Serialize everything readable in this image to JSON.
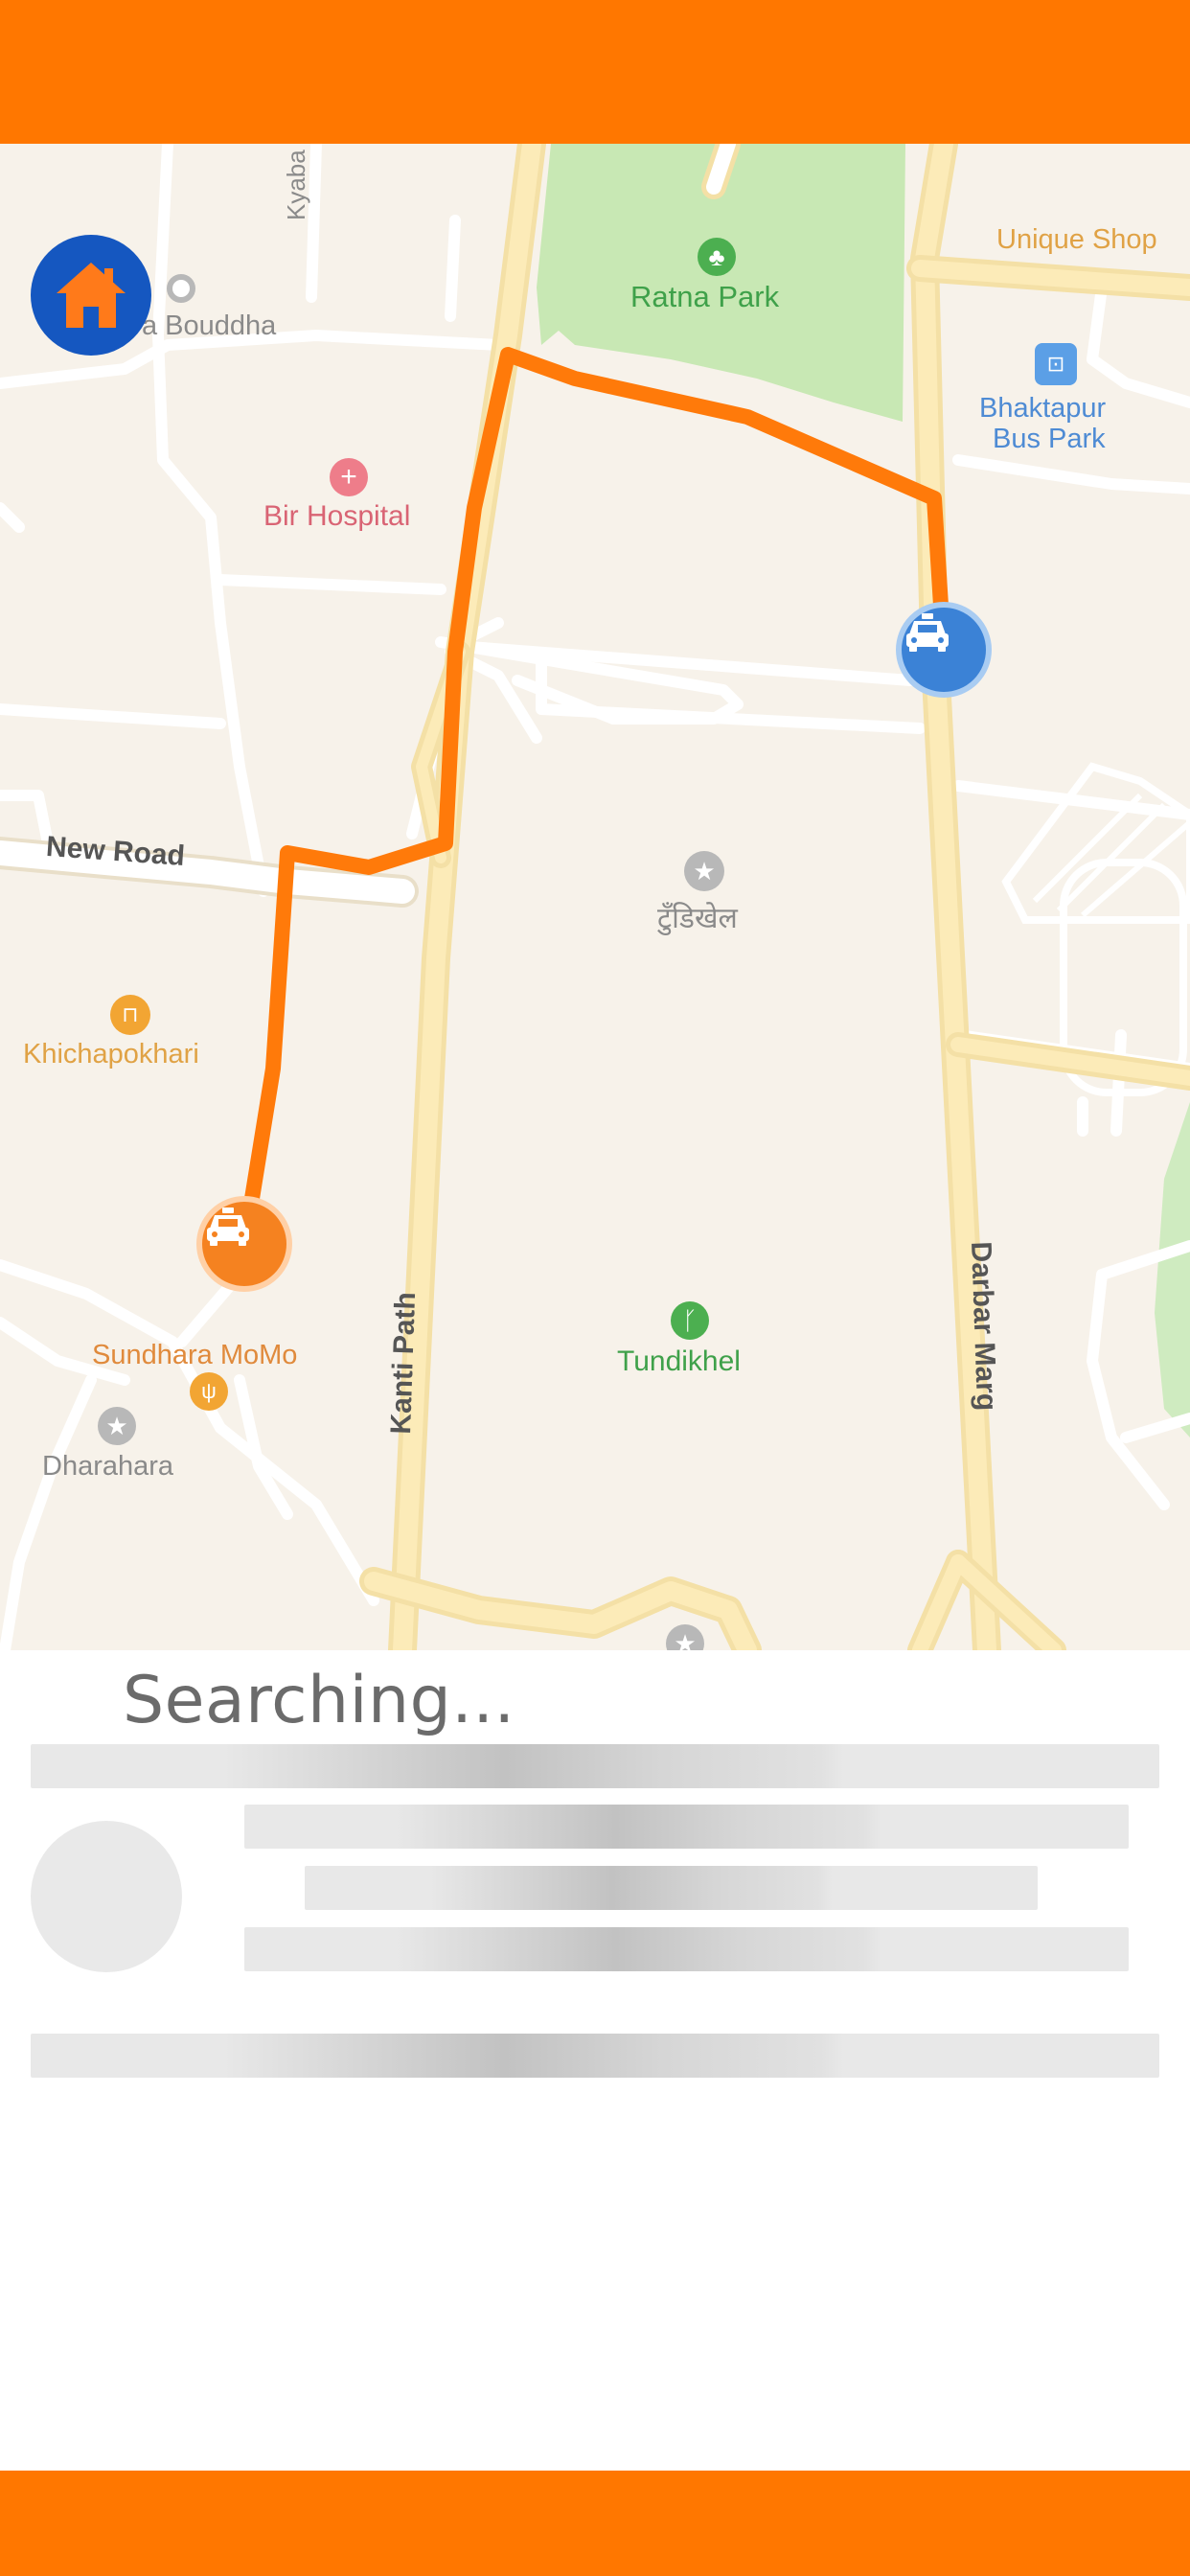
{
  "header": {
    "color": "#FF7700"
  },
  "footer": {
    "color": "#FF7700"
  },
  "home_button": {
    "icon": "home-icon",
    "color": "#1557C0"
  },
  "map": {
    "places": {
      "unique_shop": "Unique Shop",
      "ratna_park": "Ratna Park",
      "bhaktapur_line1": "Bhaktapur",
      "bhaktapur_line2": "Bus Park",
      "bouddha": "a Bouddha",
      "kyaba_mar": "Kyaba Mar",
      "bir_hospital": "Bir Hospital",
      "new_road": "New Road",
      "tudikhel_np": "टुँडिखेल",
      "khichapokhari": "Khichapokhari",
      "kanti_path": "Kanti Path",
      "darbar_marg": "Darbar Marg",
      "tundikhel": "Tundikhel",
      "sundhara_momo": "Sundhara MoMo",
      "dharahara": "Dharahara"
    },
    "route_color": "#FF7A0A",
    "driver_marker": {
      "icon": "taxi-icon",
      "color": "#3B82D6"
    },
    "rider_marker": {
      "icon": "taxi-icon",
      "color": "#F58220"
    }
  },
  "sheet": {
    "status": "Searching..."
  }
}
